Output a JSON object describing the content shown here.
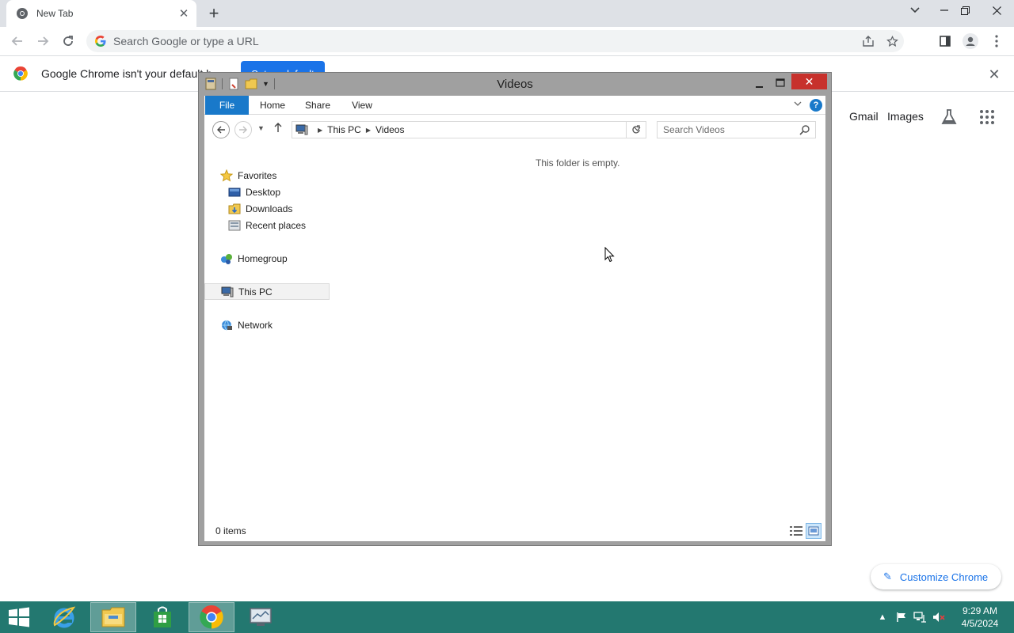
{
  "chrome": {
    "tab_title": "New Tab",
    "omnibox_placeholder": "Search Google or type a URL",
    "infobar_message": "Google Chrome isn't your default b",
    "infobar_button": "Set as default",
    "ntp_links": {
      "gmail": "Gmail",
      "images": "Images"
    },
    "customize_label": "Customize Chrome",
    "accent_color": "#1a73e8",
    "tabstrip_color": "#dee1e6"
  },
  "explorer": {
    "window_title": "Videos",
    "ribbon_tabs": [
      "File",
      "Home",
      "Share",
      "View"
    ],
    "help_label": "?",
    "breadcrumb": [
      "This PC",
      "Videos"
    ],
    "search_placeholder": "Search Videos",
    "nav_pane": {
      "favorites": "Favorites",
      "favorites_items": [
        "Desktop",
        "Downloads",
        "Recent places"
      ],
      "homegroup": "Homegroup",
      "this_pc": "This PC",
      "network": "Network"
    },
    "empty_message": "This folder is empty.",
    "status": "0 items",
    "file_tab_color": "#1979ca",
    "close_button_color": "#c7312c"
  },
  "taskbar": {
    "apps": [
      "internet-explorer",
      "file-explorer",
      "store",
      "google-chrome",
      "remote-desktop"
    ],
    "clock_time": "9:29 AM",
    "clock_date": "4/5/2024",
    "color": "#237870"
  }
}
